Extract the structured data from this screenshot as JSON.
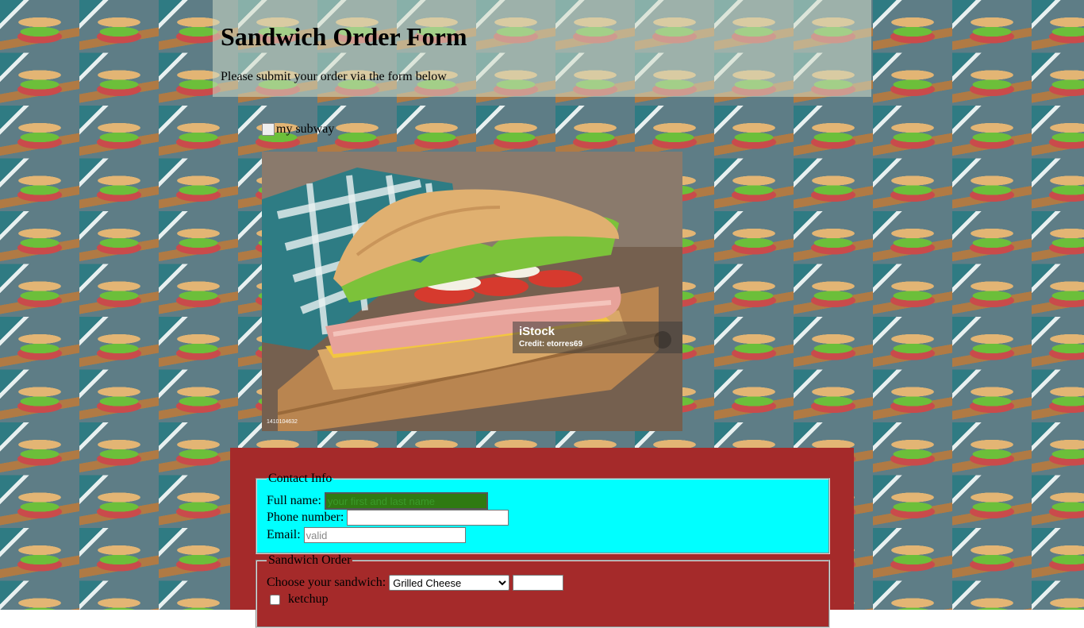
{
  "page": {
    "title": "Sandwich Order Form",
    "subtitle": "Please submit your order via the form below"
  },
  "image": {
    "alt_text": "my subway",
    "watermark_brand": "iStock",
    "watermark_credit": "Credit: etorres69",
    "stock_id": "1410104632"
  },
  "contact": {
    "legend": "Contact Info",
    "name_label": "Full name:",
    "name_placeholder": "your first and last name",
    "phone_label": "Phone number:",
    "phone_placeholder": "",
    "email_label": "Email:",
    "email_placeholder": "valid"
  },
  "order": {
    "legend": "Sandwich Order",
    "sandwich_label": "Choose your sandwich:",
    "sandwich_selected": "Grilled Cheese",
    "topping_label": "ketchup"
  },
  "colors": {
    "form_panel": "#a52a2a",
    "contact_fieldset": "#00ffff",
    "name_input_bg": "#2f7a12"
  }
}
